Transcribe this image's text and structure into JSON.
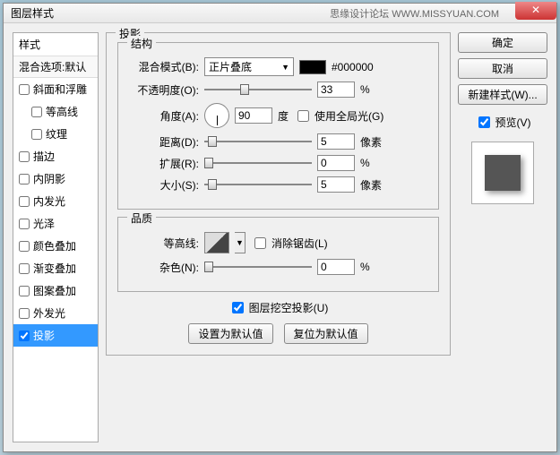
{
  "window": {
    "title": "图层样式",
    "watermark": "思缘设计论坛 WWW.MISSYUAN.COM"
  },
  "sidebar": {
    "header": "样式",
    "sub": "混合选项:默认",
    "items": [
      {
        "label": "斜面和浮雕",
        "checked": false
      },
      {
        "label": "等高线",
        "checked": false,
        "indent": true
      },
      {
        "label": "纹理",
        "checked": false,
        "indent": true
      },
      {
        "label": "描边",
        "checked": false
      },
      {
        "label": "内阴影",
        "checked": false
      },
      {
        "label": "内发光",
        "checked": false
      },
      {
        "label": "光泽",
        "checked": false
      },
      {
        "label": "颜色叠加",
        "checked": false
      },
      {
        "label": "渐变叠加",
        "checked": false
      },
      {
        "label": "图案叠加",
        "checked": false
      },
      {
        "label": "外发光",
        "checked": false
      },
      {
        "label": "投影",
        "checked": true,
        "selected": true
      }
    ]
  },
  "panel": {
    "title": "投影",
    "structure": {
      "title": "结构",
      "blend_label": "混合模式(B):",
      "blend_value": "正片叠底",
      "color_hex": "#000000",
      "opacity_label": "不透明度(O):",
      "opacity_value": "33",
      "opacity_unit": "%",
      "angle_label": "角度(A):",
      "angle_value": "90",
      "angle_unit": "度",
      "global_light": "使用全局光(G)",
      "distance_label": "距离(D):",
      "distance_value": "5",
      "distance_unit": "像素",
      "spread_label": "扩展(R):",
      "spread_value": "0",
      "spread_unit": "%",
      "size_label": "大小(S):",
      "size_value": "5",
      "size_unit": "像素"
    },
    "quality": {
      "title": "品质",
      "contour_label": "等高线:",
      "antialias": "消除锯齿(L)",
      "noise_label": "杂色(N):",
      "noise_value": "0",
      "noise_unit": "%"
    },
    "knockout": "图层挖空投影(U)",
    "set_default": "设置为默认值",
    "reset_default": "复位为默认值"
  },
  "buttons": {
    "ok": "确定",
    "cancel": "取消",
    "new_style": "新建样式(W)...",
    "preview": "预览(V)"
  }
}
